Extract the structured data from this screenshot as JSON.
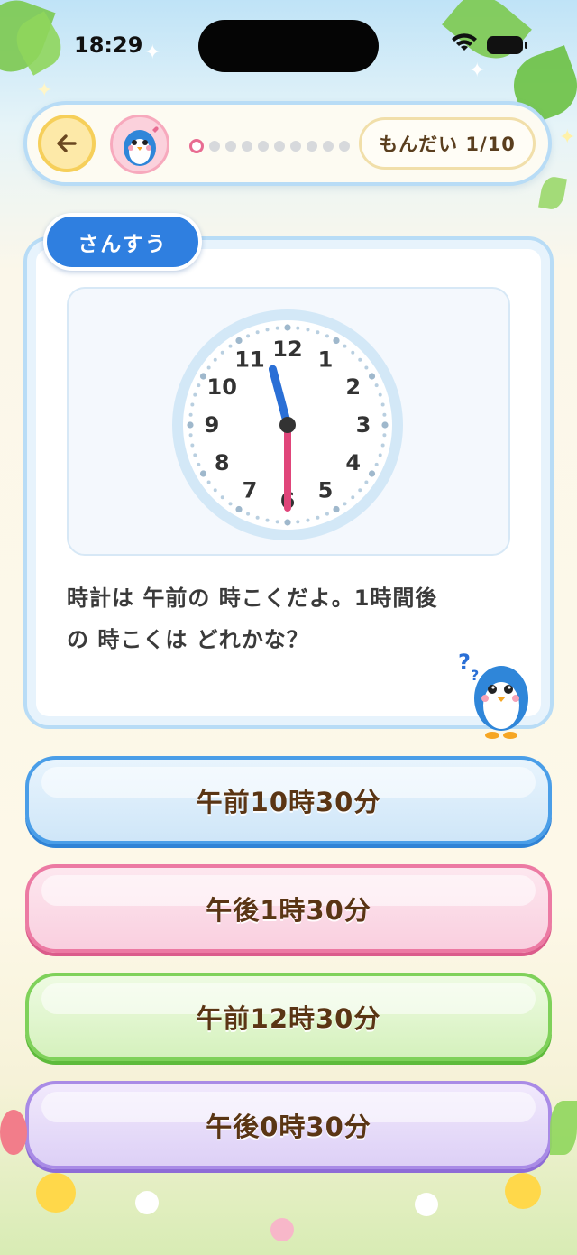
{
  "status_bar": {
    "time": "18:29"
  },
  "header": {
    "back_icon": "arrow-left-icon",
    "avatar_icon": "penguin-mascot-icon",
    "progress": {
      "current": 1,
      "total": 10
    },
    "question_counter": "もんだい 1/10"
  },
  "question": {
    "subject": "さんすう",
    "text_line1": "時計は 午前の 時こくだよ。1時間後",
    "text_line2": "の 時こくは どれかな？",
    "clock": {
      "numbers": [
        "12",
        "1",
        "2",
        "3",
        "4",
        "5",
        "6",
        "7",
        "8",
        "9",
        "10",
        "11"
      ],
      "hour": 11,
      "minute": 30,
      "hour_hand_color": "#2a6fd6",
      "minute_hand_color": "#e0457a"
    },
    "mascot_icon": "penguin-thinking-icon"
  },
  "answers": [
    {
      "label": "午前10時30分",
      "color": "#4a9ee8"
    },
    {
      "label": "午後1時30分",
      "color": "#ec7aa3"
    },
    {
      "label": "午前12時30分",
      "color": "#7fd15a"
    },
    {
      "label": "午後0時30分",
      "color": "#a98be6"
    }
  ]
}
